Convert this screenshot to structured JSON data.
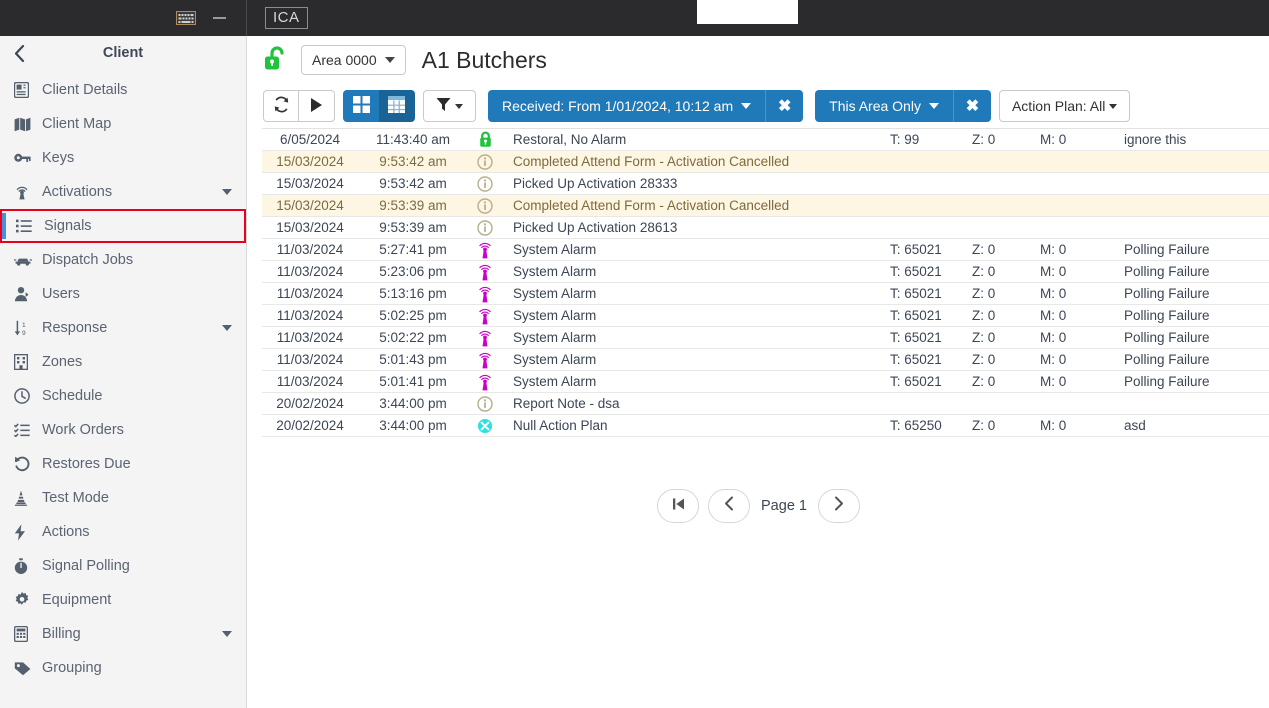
{
  "titlebar": {
    "keyboard_icon": "keyboard-icon",
    "minimize_icon": "minimize-icon",
    "app_badge": "ICA"
  },
  "sidebar": {
    "back_icon": "chevron-left-icon",
    "title": "Client",
    "items": [
      {
        "label": "Client Details",
        "icon": "contact-card-icon",
        "caret": false,
        "selected": false
      },
      {
        "label": "Client Map",
        "icon": "map-icon",
        "caret": false,
        "selected": false
      },
      {
        "label": "Keys",
        "icon": "key-icon",
        "caret": false,
        "selected": false
      },
      {
        "label": "Activations",
        "icon": "antenna-icon",
        "caret": true,
        "selected": false
      },
      {
        "label": "Signals",
        "icon": "list-icon",
        "caret": false,
        "selected": true
      },
      {
        "label": "Dispatch Jobs",
        "icon": "vehicle-icon",
        "caret": false,
        "selected": false
      },
      {
        "label": "Users",
        "icon": "user-icon",
        "caret": false,
        "selected": false
      },
      {
        "label": "Response",
        "icon": "sort-icon",
        "caret": true,
        "selected": false
      },
      {
        "label": "Zones",
        "icon": "building-icon",
        "caret": false,
        "selected": false
      },
      {
        "label": "Schedule",
        "icon": "clock-icon",
        "caret": false,
        "selected": false
      },
      {
        "label": "Work Orders",
        "icon": "checklist-icon",
        "caret": false,
        "selected": false
      },
      {
        "label": "Restores Due",
        "icon": "undo-icon",
        "caret": false,
        "selected": false
      },
      {
        "label": "Test Mode",
        "icon": "cone-icon",
        "caret": false,
        "selected": false
      },
      {
        "label": "Actions",
        "icon": "bolt-icon",
        "caret": false,
        "selected": false
      },
      {
        "label": "Signal Polling",
        "icon": "stopwatch-icon",
        "caret": false,
        "selected": false
      },
      {
        "label": "Equipment",
        "icon": "gear-icon",
        "caret": false,
        "selected": false
      },
      {
        "label": "Billing",
        "icon": "calculator-icon",
        "caret": true,
        "selected": false
      },
      {
        "label": "Grouping",
        "icon": "tag-icon",
        "caret": false,
        "selected": false
      }
    ]
  },
  "header": {
    "lock_icon": "unlocked-padlock-icon",
    "area_label": "Area 0000",
    "client_name": "A1 Butchers"
  },
  "toolbar": {
    "refresh_icon": "refresh-icon",
    "play_icon": "play-icon",
    "tile_view_icon": "grid-view-icon",
    "table_view_icon": "table-view-icon",
    "filter_icon": "filter-icon",
    "received_filter": "Received: From 1/01/2024, 10:12 am",
    "received_clear": "✖",
    "area_filter": "This Area Only",
    "area_clear": "✖",
    "action_plan": "Action Plan: All"
  },
  "colors": {
    "accent_blue": "#2079b8",
    "accent_blue_dark": "#1a6396",
    "selected_outline_red": "#e8001d",
    "selected_bar_blue": "#4a90d9",
    "alt_row_bg": "#fdf6e3",
    "alt_row_text": "#7d6b3f",
    "lock_green": "#1fc43c",
    "antenna_magenta": "#cc00cc",
    "null_plan_cyan": "#2ae0e0",
    "info_beige": "#b9ae8c"
  },
  "table": {
    "rows": [
      {
        "date": "6/05/2024",
        "time": "11:43:40 am",
        "icon": "green-padlock-icon",
        "desc": "Restoral, No Alarm",
        "t": "T: 99",
        "z": "Z: 0",
        "m": "M: 0",
        "note": "ignore this",
        "alt": false
      },
      {
        "date": "15/03/2024",
        "time": "9:53:42 am",
        "icon": "info-circle-icon",
        "desc": "Completed Attend Form - Activation Cancelled",
        "t": "",
        "z": "",
        "m": "",
        "note": "",
        "alt": true
      },
      {
        "date": "15/03/2024",
        "time": "9:53:42 am",
        "icon": "info-circle-icon",
        "desc": "Picked Up Activation 28333",
        "t": "",
        "z": "",
        "m": "",
        "note": "",
        "alt": false
      },
      {
        "date": "15/03/2024",
        "time": "9:53:39 am",
        "icon": "info-circle-icon",
        "desc": "Completed Attend Form - Activation Cancelled",
        "t": "",
        "z": "",
        "m": "",
        "note": "",
        "alt": true
      },
      {
        "date": "15/03/2024",
        "time": "9:53:39 am",
        "icon": "info-circle-icon",
        "desc": "Picked Up Activation 28613",
        "t": "",
        "z": "",
        "m": "",
        "note": "",
        "alt": false
      },
      {
        "date": "11/03/2024",
        "time": "5:27:41 pm",
        "icon": "antenna-alarm-icon",
        "desc": "System Alarm",
        "t": "T: 65021",
        "z": "Z: 0",
        "m": "M: 0",
        "note": "Polling Failure",
        "alt": false
      },
      {
        "date": "11/03/2024",
        "time": "5:23:06 pm",
        "icon": "antenna-alarm-icon",
        "desc": "System Alarm",
        "t": "T: 65021",
        "z": "Z: 0",
        "m": "M: 0",
        "note": "Polling Failure",
        "alt": false
      },
      {
        "date": "11/03/2024",
        "time": "5:13:16 pm",
        "icon": "antenna-alarm-icon",
        "desc": "System Alarm",
        "t": "T: 65021",
        "z": "Z: 0",
        "m": "M: 0",
        "note": "Polling Failure",
        "alt": false
      },
      {
        "date": "11/03/2024",
        "time": "5:02:25 pm",
        "icon": "antenna-alarm-icon",
        "desc": "System Alarm",
        "t": "T: 65021",
        "z": "Z: 0",
        "m": "M: 0",
        "note": "Polling Failure",
        "alt": false
      },
      {
        "date": "11/03/2024",
        "time": "5:02:22 pm",
        "icon": "antenna-alarm-icon",
        "desc": "System Alarm",
        "t": "T: 65021",
        "z": "Z: 0",
        "m": "M: 0",
        "note": "Polling Failure",
        "alt": false
      },
      {
        "date": "11/03/2024",
        "time": "5:01:43 pm",
        "icon": "antenna-alarm-icon",
        "desc": "System Alarm",
        "t": "T: 65021",
        "z": "Z: 0",
        "m": "M: 0",
        "note": "Polling Failure",
        "alt": false
      },
      {
        "date": "11/03/2024",
        "time": "5:01:41 pm",
        "icon": "antenna-alarm-icon",
        "desc": "System Alarm",
        "t": "T: 65021",
        "z": "Z: 0",
        "m": "M: 0",
        "note": "Polling Failure",
        "alt": false
      },
      {
        "date": "20/02/2024",
        "time": "3:44:00 pm",
        "icon": "info-circle-icon",
        "desc": "Report Note - dsa",
        "t": "",
        "z": "",
        "m": "",
        "note": "",
        "alt": false
      },
      {
        "date": "20/02/2024",
        "time": "3:44:00 pm",
        "icon": "null-action-icon",
        "desc": "Null Action Plan",
        "t": "T: 65250",
        "z": "Z: 0",
        "m": "M: 0",
        "note": "asd",
        "alt": false
      }
    ]
  },
  "pagination": {
    "first_icon": "first-page-icon",
    "prev_icon": "previous-page-icon",
    "page_label": "Page 1",
    "next_icon": "next-page-icon"
  }
}
